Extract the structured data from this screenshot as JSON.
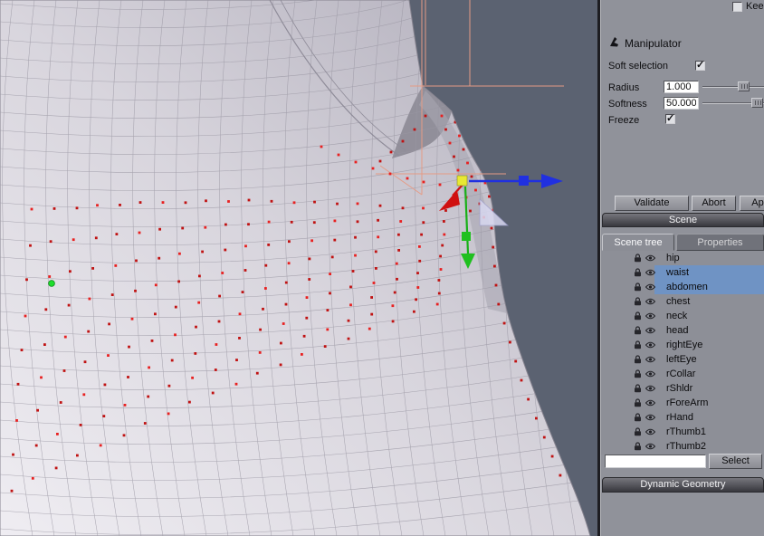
{
  "colors": {
    "viewport_bg": "#5b6271",
    "selection_blue": "#6f93c4",
    "axis_x_red": "#d01010",
    "axis_y_green": "#20c020",
    "axis_z_blue": "#2030e0",
    "soft_dot_red": "#c01212",
    "guide_pink": "#e59b85"
  },
  "top": {
    "keep_checkbox_label": "Kee"
  },
  "manipulator": {
    "title": "Manipulator",
    "soft_selection_label": "Soft selection",
    "radius_label": "Radius",
    "radius_value": "1.000",
    "softness_label": "Softness",
    "softness_value": "50.000",
    "freeze_label": "Freeze"
  },
  "actions": {
    "validate": "Validate",
    "abort": "Abort",
    "apply_partial": "Ap"
  },
  "scene": {
    "header": "Scene",
    "tabs": [
      {
        "label": "Scene tree"
      },
      {
        "label": "Properties"
      }
    ],
    "items": [
      {
        "label": "hip",
        "selected": false
      },
      {
        "label": "waist",
        "selected": true
      },
      {
        "label": "abdomen",
        "selected": true
      },
      {
        "label": "chest",
        "selected": false
      },
      {
        "label": "neck",
        "selected": false
      },
      {
        "label": "head",
        "selected": false
      },
      {
        "label": "rightEye",
        "selected": false
      },
      {
        "label": "leftEye",
        "selected": false
      },
      {
        "label": "rCollar",
        "selected": false
      },
      {
        "label": "rShldr",
        "selected": false
      },
      {
        "label": "rForeArm",
        "selected": false
      },
      {
        "label": "rHand",
        "selected": false
      },
      {
        "label": "rThumb1",
        "selected": false
      },
      {
        "label": "rThumb2",
        "selected": false
      }
    ],
    "filter_value": "",
    "select_button": "Select"
  },
  "dynamic_geometry": {
    "header": "Dynamic Geometry"
  }
}
